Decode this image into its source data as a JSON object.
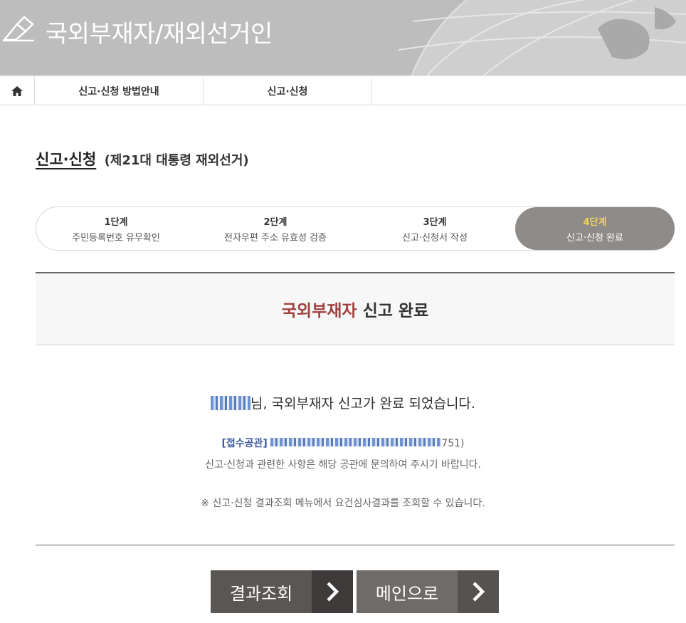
{
  "header": {
    "title": "국외부재자/재외선거인"
  },
  "nav": {
    "tabs": [
      {
        "label": "신고·신청 방법안내"
      },
      {
        "label": "신고·신청"
      }
    ]
  },
  "page": {
    "title": "신고·신청",
    "subtitle": "(제21대 대통령 재외선거)"
  },
  "steps": [
    {
      "num": "1단계",
      "desc": "주민등록번호 유무확인"
    },
    {
      "num": "2단계",
      "desc": "전자우편 주소 유효성 검증"
    },
    {
      "num": "3단계",
      "desc": "신고·신청서 작성"
    },
    {
      "num": "4단계",
      "desc": "신고·신청 완료"
    }
  ],
  "complete": {
    "accent": "국외부재자",
    "rest": "신고 완료"
  },
  "message": {
    "text": "님, 국외부재자 신고가 완료 되었습니다."
  },
  "office": {
    "label": "[접수공관]",
    "tail": "751)",
    "note": "신고·신청과 관련한 사항은 해당 공관에 문의하여 주시기 바랍니다."
  },
  "notice": "※ 신고·신청 결과조회 메뉴에서 요건심사결과를 조회할 수 있습니다.",
  "buttons": {
    "result": "결과조회",
    "main": "메인으로"
  },
  "colors": {
    "header_bg": "#bdbdbd",
    "accent_red": "#a14242",
    "active_step_bg": "#8f8b88",
    "active_step_num": "#f2d35c",
    "office_label": "#3b5b9e"
  }
}
